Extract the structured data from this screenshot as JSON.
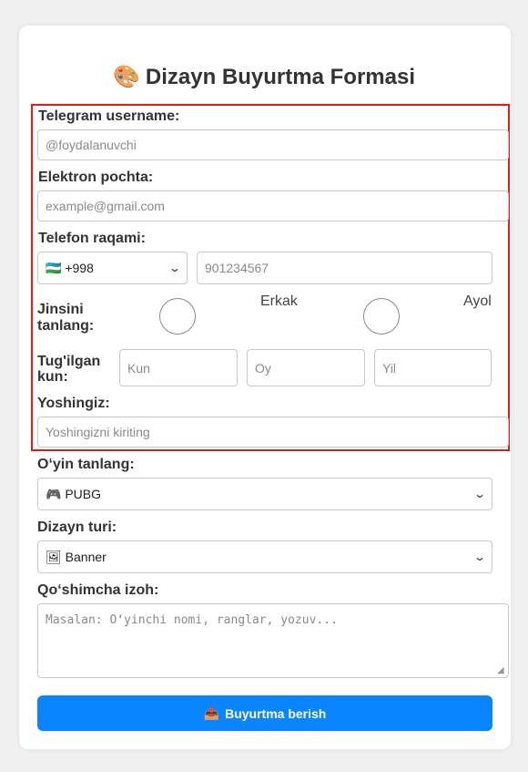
{
  "form": {
    "title": "Dizayn Buyurtma Formasi",
    "title_icon": "🎨",
    "telegram": {
      "label": "Telegram username:",
      "placeholder": "@foydalanuvchi"
    },
    "email": {
      "label": "Elektron pochta:",
      "placeholder": "example@gmail.com"
    },
    "phone": {
      "label": "Telefon raqami:",
      "country_code": "🇺🇿 +998",
      "placeholder": "901234567"
    },
    "gender": {
      "label_line1": "Jinsini",
      "label_line2": "tanlang:",
      "option_male": "Erkak",
      "option_female": "Ayol"
    },
    "birthday": {
      "label_line1": "Tug'ilgan",
      "label_line2": "kun:",
      "day_placeholder": "Kun",
      "month_placeholder": "Oy",
      "year_placeholder": "Yil"
    },
    "age": {
      "label": "Yoshingiz:",
      "placeholder": "Yoshingizni kiriting"
    },
    "game": {
      "label": "O‘yin tanlang:",
      "selected": "🎮 PUBG"
    },
    "design_type": {
      "label": "Dizayn turi:",
      "selected": "🖼 Banner"
    },
    "note": {
      "label": "Qo‘shimcha izoh:",
      "placeholder": "Masalan: O‘yinchi nomi, ranglar, yozuv..."
    },
    "submit": {
      "icon": "📤",
      "label": "Buyurtma berish"
    }
  },
  "colors": {
    "accent": "#0a84ff",
    "highlight_border": "#e01b1b"
  }
}
